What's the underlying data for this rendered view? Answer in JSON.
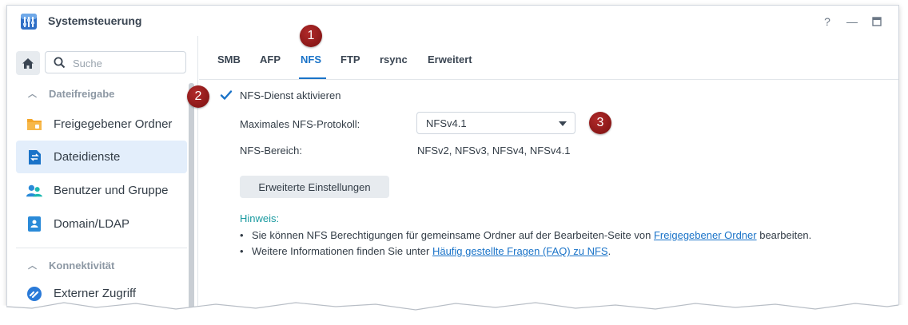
{
  "window": {
    "title": "Systemsteuerung"
  },
  "titlebar": {
    "help": "?",
    "minimize": "—",
    "maximize": "▭"
  },
  "sidebar": {
    "search_placeholder": "Suche",
    "sections": [
      {
        "label": "Dateifreigabe"
      },
      {
        "label": "Konnektivität"
      }
    ],
    "items": [
      {
        "label": "Freigegebener Ordner",
        "icon": "folder-icon",
        "color": "#f4a62a"
      },
      {
        "label": "Dateidienste",
        "icon": "file-services-icon",
        "color": "#1a73c8",
        "active": true
      },
      {
        "label": "Benutzer und Gruppe",
        "icon": "users-icon",
        "color": "#1aa0b8"
      },
      {
        "label": "Domain/LDAP",
        "icon": "domain-icon",
        "color": "#2a8ad8"
      },
      {
        "label": "Externer Zugriff",
        "icon": "external-access-icon",
        "color": "#2a7ad8"
      }
    ]
  },
  "tabs": [
    {
      "label": "SMB"
    },
    {
      "label": "AFP"
    },
    {
      "label": "NFS",
      "active": true
    },
    {
      "label": "FTP"
    },
    {
      "label": "rsync"
    },
    {
      "label": "Erweitert"
    }
  ],
  "badges": [
    "1",
    "2",
    "3"
  ],
  "nfs": {
    "enable_label": "NFS-Dienst aktivieren",
    "enabled": true,
    "max_protocol_label": "Maximales NFS-Protokoll:",
    "max_protocol_value": "NFSv4.1",
    "range_label": "NFS-Bereich:",
    "range_value": "NFSv2, NFSv3, NFSv4, NFSv4.1",
    "advanced_button": "Erweiterte Einstellungen"
  },
  "hint": {
    "title": "Hinweis:",
    "line1_pre": "Sie können NFS Berechtigungen für gemeinsame Ordner auf der Bearbeiten-Seite von ",
    "line1_link": "Freigegebener Ordner",
    "line1_post": " bearbeiten.",
    "line2_pre": "Weitere Informationen finden Sie unter ",
    "line2_link": "Häufig gestellte Fragen (FAQ) zu NFS",
    "line2_post": "."
  },
  "colors": {
    "accent": "#1a73c8",
    "hint": "#1a9aa0",
    "badge": "#8b1a1a",
    "active_item_bg": "#e3eefb"
  }
}
